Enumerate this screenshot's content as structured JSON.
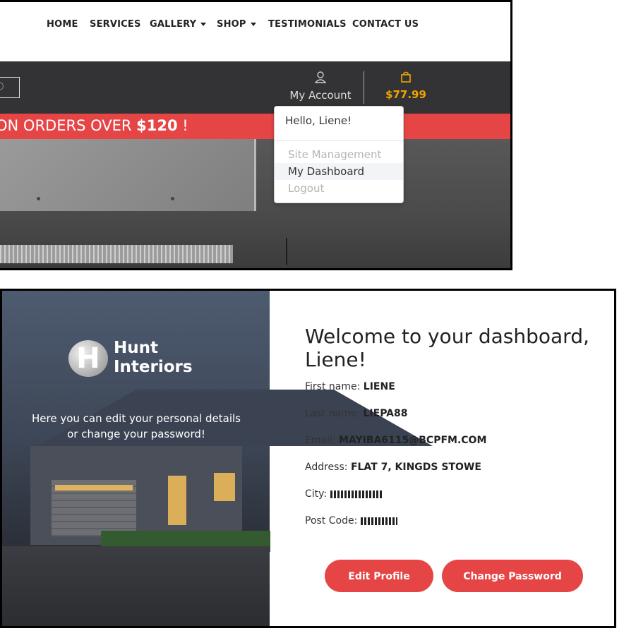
{
  "nav": {
    "items": [
      {
        "label": "HOME",
        "dropdown": false
      },
      {
        "label": "SERVICES",
        "dropdown": false
      },
      {
        "label": "GALLERY",
        "dropdown": true
      },
      {
        "label": "SHOP",
        "dropdown": true
      },
      {
        "label": "TESTIMONIALS",
        "dropdown": false
      },
      {
        "label": "CONTACT US",
        "dropdown": false
      }
    ]
  },
  "header": {
    "account_label": "My Account",
    "cart_total": "$77.99",
    "account_icon": "user-icon",
    "cart_icon": "shopping-bag-icon",
    "search_icon": "search-icon",
    "bar_color": "#333335",
    "cart_color": "#f2a400"
  },
  "promo": {
    "text_prefix": "ON ORDERS OVER",
    "amount": "$120",
    "suffix": "!",
    "color": "#e64546"
  },
  "account_menu": {
    "greeting": "Hello, Liene!",
    "items": [
      {
        "label": "Site Management",
        "active": false
      },
      {
        "label": "My Dashboard",
        "active": true
      },
      {
        "label": "Logout",
        "active": false
      }
    ]
  },
  "brand": {
    "logo_letter": "H",
    "name_line1": "Hunt",
    "name_line2": "Interiors"
  },
  "side": {
    "tagline_line1": "Here you can edit your personal details",
    "tagline_line2": "or change your password!"
  },
  "dashboard": {
    "title_line1": "Welcome to your dashboard,",
    "title_line2": "Liene!",
    "fields": [
      {
        "label": "First name:",
        "value": "LIENE"
      },
      {
        "label": "Last name:",
        "value": "LIEPA88"
      },
      {
        "label": "Email:",
        "value": "MAYIBA6115@BCPFM.COM"
      },
      {
        "label": "Address:",
        "value": "FLAT 7, KINGDS STOWE"
      },
      {
        "label": "City:",
        "value": ""
      },
      {
        "label": "Post Code:",
        "value": ""
      }
    ],
    "edit_profile_label": "Edit Profile",
    "change_password_label": "Change Password",
    "button_color": "#e64546"
  }
}
